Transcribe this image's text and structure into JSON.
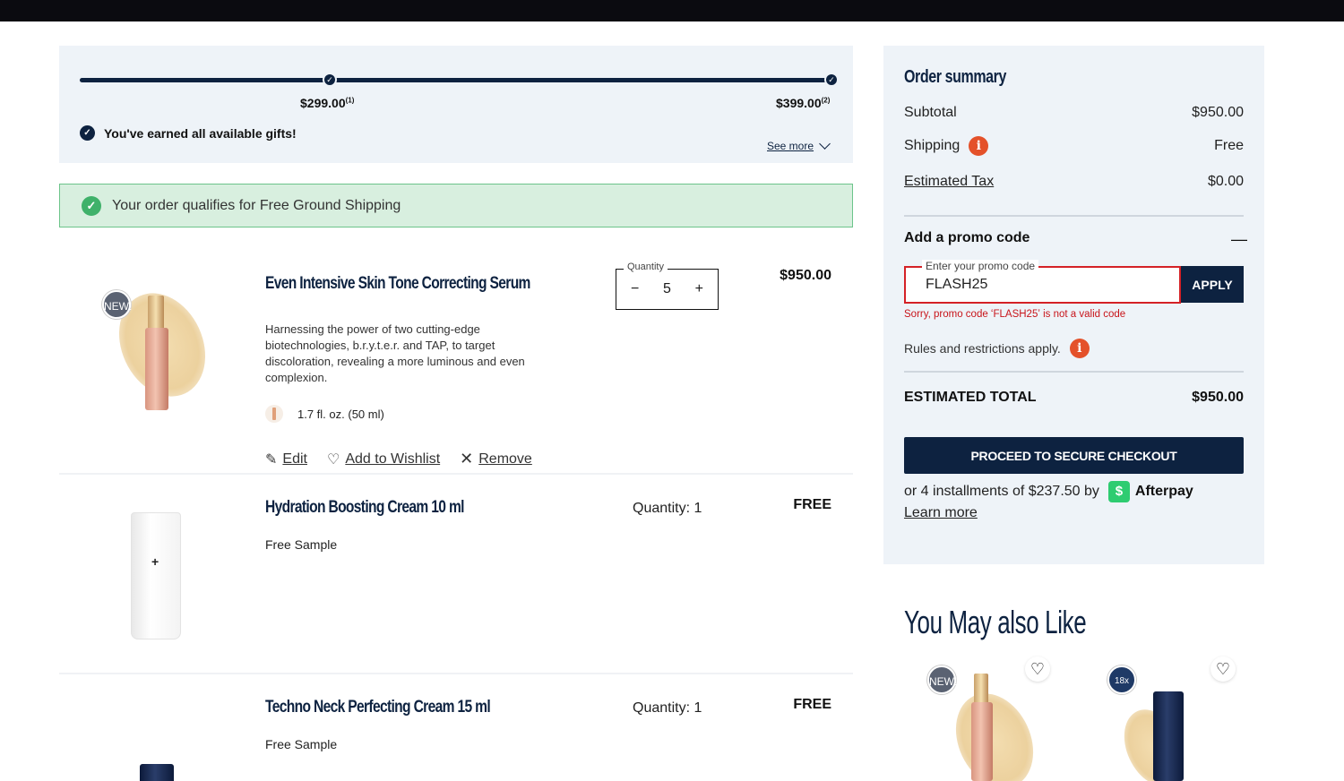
{
  "gifts": {
    "tier1_price": "$299.00",
    "tier1_sup": "(1)",
    "tier2_price": "$399.00",
    "tier2_sup": "(2)",
    "earned_text": "You've earned all available gifts!",
    "see_more": "See more"
  },
  "shipping_banner": {
    "text": "Your order qualifies for Free Ground Shipping"
  },
  "cart_items": [
    {
      "badge": "NEW!",
      "name": "Even Intensive Skin Tone Correcting Serum",
      "description": "Harnessing the power of two cutting-edge biotechnologies, b.r.y.t.e.r. and TAP, to target discoloration, revealing a more luminous and even complexion.",
      "size": "1.7 fl. oz. (50 ml)",
      "quantity_legend": "Quantity",
      "quantity": "5",
      "minus": "−",
      "plus": "+",
      "price": "$950.00",
      "edit_label": "Edit",
      "wishlist_label": "Add to Wishlist",
      "remove_label": "Remove"
    },
    {
      "name": "Hydration Boosting Cream 10 ml",
      "subtitle": "Free Sample",
      "quantity_text": "Quantity: 1",
      "price": "FREE"
    },
    {
      "name": "Techno Neck Perfecting Cream 15 ml",
      "subtitle": "Free Sample",
      "quantity_text": "Quantity: 1",
      "price": "FREE"
    }
  ],
  "summary": {
    "title": "Order summary",
    "subtotal_label": "Subtotal",
    "subtotal_value": "$950.00",
    "shipping_label": "Shipping",
    "shipping_value": "Free",
    "tax_label": "Estimated Tax",
    "tax_value": "$0.00",
    "promo_title": "Add a promo code",
    "promo_toggle": "—",
    "promo_legend": "Enter your promo code",
    "promo_value": "FLASH25",
    "apply_label": "APPLY",
    "promo_error": "Sorry, promo code ʻFLASH25ʼ is not a valid code",
    "rules_text": "Rules and restrictions apply.",
    "estimated_total_label": "ESTIMATED TOTAL",
    "estimated_total_value": "$950.00",
    "checkout_label": "PROCEED TO SECURE CHECKOUT",
    "afterpay_text": "or 4 installments of $237.50 by",
    "afterpay_brand": "Afterpay",
    "learn_more": "Learn more",
    "info_icon_glyph": "i"
  },
  "recommendations": {
    "title": "You May also Like",
    "items": [
      {
        "badge": "NEW!"
      },
      {
        "badge": "18x"
      }
    ]
  },
  "colors": {
    "navy": "#0d2240",
    "panel_bg": "#eef3f8",
    "success_green": "#3fb16a",
    "error_red": "#d42126",
    "info_orange": "#e4512a",
    "afterpay_green": "#2ecc71"
  },
  "icons": [
    "check-circle-icon",
    "chevron-down-icon",
    "pencil-icon",
    "heart-icon",
    "x-icon",
    "info-icon",
    "afterpay-icon"
  ]
}
